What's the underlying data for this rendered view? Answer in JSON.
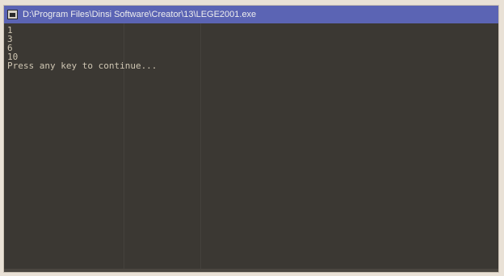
{
  "window": {
    "title": "D:\\Program Files\\Dinsi Software\\Creator\\13\\LEGE2001.exe"
  },
  "console": {
    "lines": [
      "1",
      "3",
      "6",
      "10",
      "Press any key to continue..."
    ]
  },
  "colors": {
    "titlebar": "#5b64b4",
    "console_bg": "#3b3833",
    "console_text": "#cfc6b3"
  },
  "icons": {
    "app": "console-app-icon"
  }
}
